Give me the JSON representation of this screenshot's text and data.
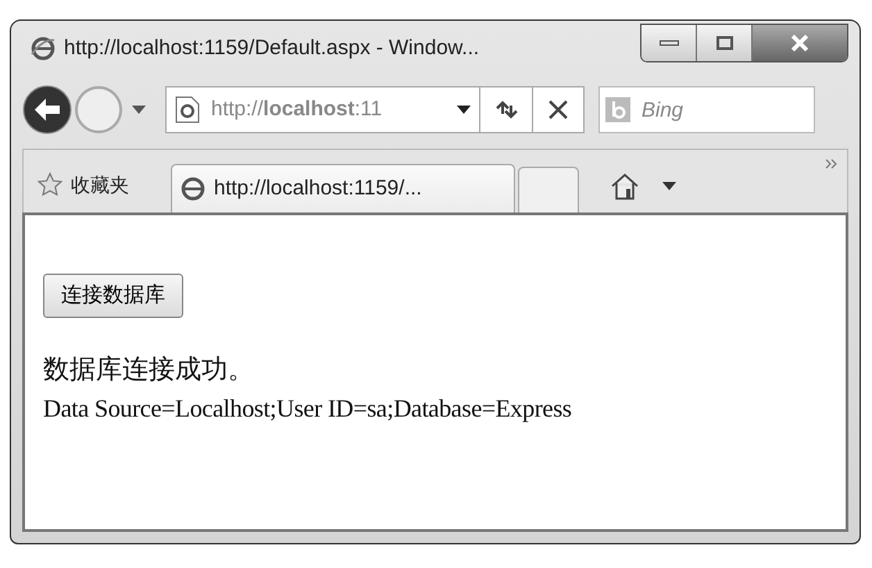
{
  "window": {
    "title": "http://localhost:1159/Default.aspx - Window..."
  },
  "address_bar": {
    "url": "http://**localhost**:11"
  },
  "search": {
    "placeholder": "Bing"
  },
  "favorites": {
    "label": "收藏夹"
  },
  "tabs": [
    {
      "label": "http://localhost:1159/...",
      "selected": true
    }
  ],
  "page": {
    "button": "连接数据库",
    "message": "数据库连接成功。",
    "connection_string": "Data Source=Localhost;User ID=sa;Database=Express"
  }
}
